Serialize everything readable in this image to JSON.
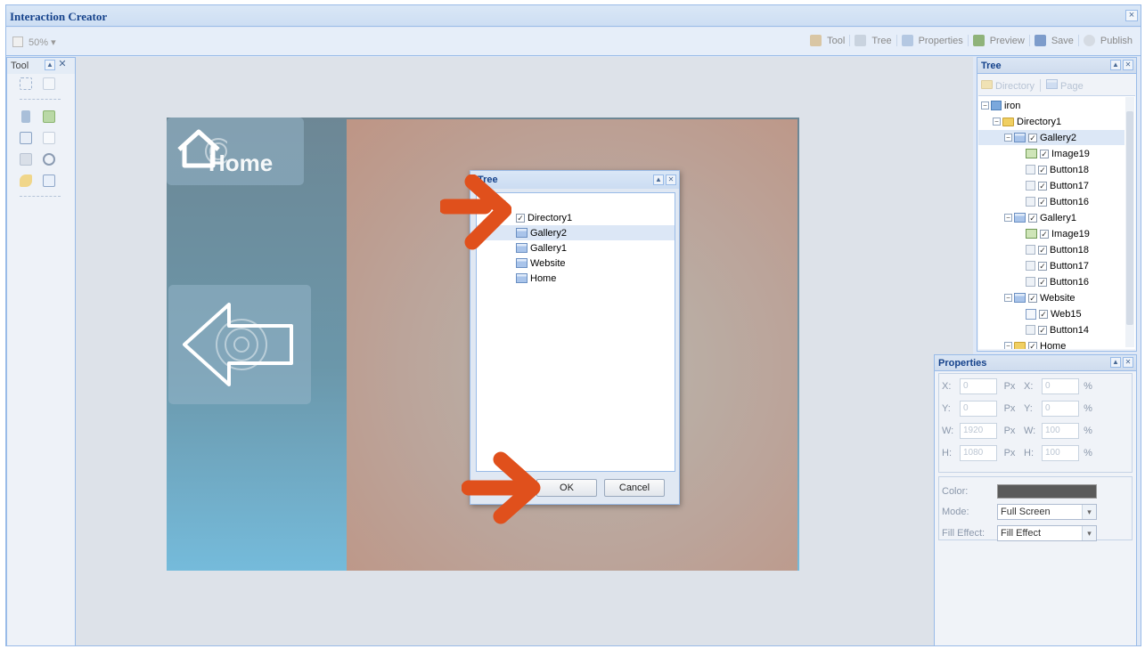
{
  "window": {
    "title": "Interaction Creator",
    "close": "×"
  },
  "toolbar": {
    "zoom": "50% ▾",
    "buttons": [
      {
        "label": "Tool",
        "icon": "tool-icon",
        "color": "#c9b08a"
      },
      {
        "label": "Tree",
        "icon": "tree-icon",
        "color": "#b7c3d4"
      },
      {
        "label": "Properties",
        "icon": "properties-icon",
        "color": "#9fb8d8"
      },
      {
        "label": "Preview",
        "icon": "preview-icon",
        "color": "#6f9a55"
      },
      {
        "label": "Save",
        "icon": "save-icon",
        "color": "#5b7fb4"
      },
      {
        "label": "Publish",
        "icon": "publish-icon",
        "color": "#c8cfd8"
      }
    ]
  },
  "tool_panel": {
    "title": "Tool"
  },
  "stage": {
    "home_label": "Home"
  },
  "dialog": {
    "title": "Tree",
    "items": [
      {
        "label": "iron",
        "icon": "root-icon"
      },
      {
        "label": "Directory1",
        "icon": "checkbox-icon",
        "checked": true
      },
      {
        "label": "Gallery2",
        "icon": "page-icon",
        "selected": true
      },
      {
        "label": "Gallery1",
        "icon": "page-icon"
      },
      {
        "label": "Website",
        "icon": "page-icon"
      },
      {
        "label": "Home",
        "icon": "page-icon"
      }
    ],
    "ok": "OK",
    "cancel": "Cancel"
  },
  "tree_panel": {
    "title": "Tree",
    "tools": [
      "Directory",
      "Page"
    ],
    "items": [
      {
        "label": "iron",
        "level": 0,
        "icon": "root-icon"
      },
      {
        "label": "Directory1",
        "level": 1,
        "icon": "folder-icon"
      },
      {
        "label": "Gallery2",
        "level": 2,
        "icon": "page-icon",
        "checked": true,
        "selected": true
      },
      {
        "label": "Image19",
        "level": 3,
        "icon": "image-icon",
        "checked": true
      },
      {
        "label": "Button18",
        "level": 3,
        "icon": "button-icon",
        "checked": true
      },
      {
        "label": "Button17",
        "level": 3,
        "icon": "button-icon",
        "checked": true
      },
      {
        "label": "Button16",
        "level": 3,
        "icon": "button-icon",
        "checked": true
      },
      {
        "label": "Gallery1",
        "level": 2,
        "icon": "page-icon",
        "checked": true
      },
      {
        "label": "Image19",
        "level": 3,
        "icon": "image-icon",
        "checked": true
      },
      {
        "label": "Button18",
        "level": 3,
        "icon": "button-icon",
        "checked": true
      },
      {
        "label": "Button17",
        "level": 3,
        "icon": "button-icon",
        "checked": true
      },
      {
        "label": "Button16",
        "level": 3,
        "icon": "button-icon",
        "checked": true
      },
      {
        "label": "Website",
        "level": 2,
        "icon": "page-icon",
        "checked": true
      },
      {
        "label": "Web15",
        "level": 3,
        "icon": "web-icon",
        "checked": true
      },
      {
        "label": "Button14",
        "level": 3,
        "icon": "button-icon",
        "checked": true
      },
      {
        "label": "Home",
        "level": 2,
        "icon": "folder-icon",
        "checked": true
      }
    ]
  },
  "properties": {
    "title": "Properties",
    "rows": [
      {
        "l1": "X:",
        "v1": "0",
        "u1": "Px",
        "l2": "X:",
        "v2": "0",
        "u2": "%"
      },
      {
        "l1": "Y:",
        "v1": "0",
        "u1": "Px",
        "l2": "Y:",
        "v2": "0",
        "u2": "%"
      },
      {
        "l1": "W:",
        "v1": "1920",
        "u1": "Px",
        "l2": "W:",
        "v2": "100",
        "u2": "%"
      },
      {
        "l1": "H:",
        "v1": "1080",
        "u1": "Px",
        "l2": "H:",
        "v2": "100",
        "u2": "%"
      }
    ],
    "color_label": "Color:",
    "color_value": "#5a5a5a",
    "mode_label": "Mode:",
    "mode_value": "Full Screen",
    "fill_label": "Fill Effect:",
    "fill_value": "Fill Effect"
  },
  "colors": {
    "arrow": "#e0501c",
    "accent": "#15428b"
  }
}
